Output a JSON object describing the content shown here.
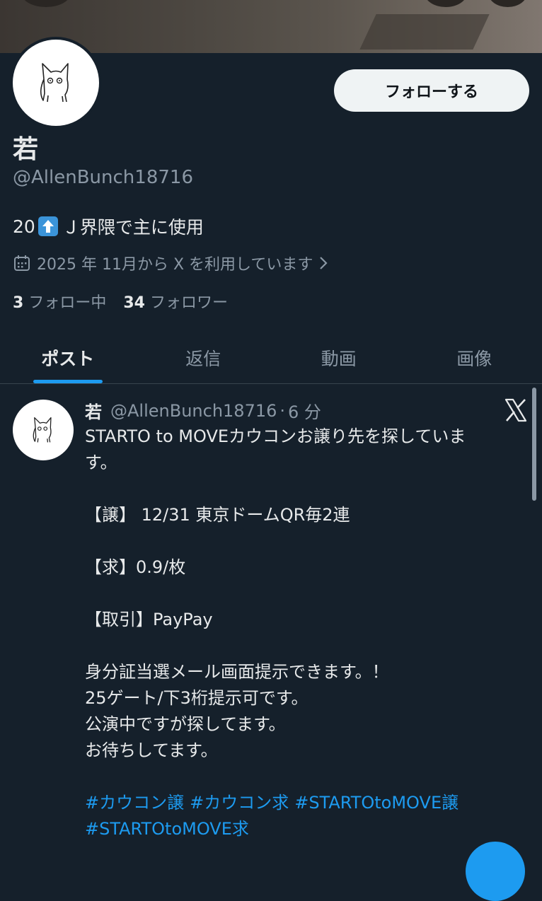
{
  "profile": {
    "follow_label": "フォローする",
    "display_name": "若",
    "handle": "@AllenBunch18716",
    "bio_prefix": "20",
    "bio_suffix": "Ｊ界隈で主に使用",
    "joined": "2025 年 11月から X を利用しています",
    "following_count": "3",
    "following_label": "フォロー中",
    "followers_count": "34",
    "followers_label": "フォロワー"
  },
  "tabs": [
    {
      "label": "ポスト",
      "active": true
    },
    {
      "label": "返信",
      "active": false
    },
    {
      "label": "動画",
      "active": false
    },
    {
      "label": "画像",
      "active": false
    }
  ],
  "post": {
    "name": "若",
    "handle": "@AllenBunch18716",
    "separator": "·",
    "time": "6 分",
    "lines": [
      "STARTO to MOVEカウコンお譲り先を探していま",
      "す。",
      "",
      "【譲】 12/31 東京ドームQR毎2連",
      "",
      "【求】0.9/枚",
      "",
      "【取引】PayPay",
      "",
      "身分証当選メール画面提示できます。！",
      "25ゲート/下3桁提示可です。",
      "公演中ですが探してます。",
      "お待ちしてます。",
      ""
    ],
    "hashtags": [
      "#カウコン譲",
      "#カウコン求",
      "#STARTOtoMOVE譲",
      "#STARTOtoMOVE求"
    ]
  },
  "colors": {
    "background": "#15202b",
    "accent": "#1d9bf0",
    "text_secondary": "#8b98a5"
  },
  "icons": [
    "calendar-icon",
    "chevron-right-icon",
    "x-logo-icon",
    "up-arrow-emoji"
  ]
}
